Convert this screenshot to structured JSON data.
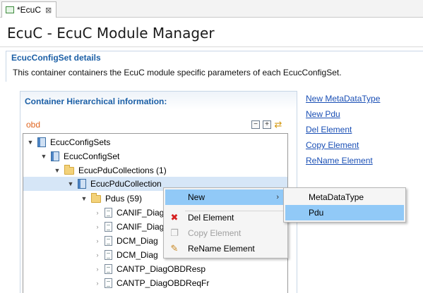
{
  "tab": {
    "label": "*EcuC",
    "close": "⊠"
  },
  "page": {
    "title": "EcuC - EcuC Module Manager"
  },
  "section": {
    "title": "EcucConfigSet details",
    "description": "This container containers the EcuC module specific parameters of each EcucConfigSet."
  },
  "container": {
    "title": "Container Hierarchical information:",
    "filter_label": "obd",
    "tools": [
      "collapse-all-icon",
      "expand-all-icon",
      "link-sync-icon"
    ]
  },
  "tree": {
    "nodes": [
      {
        "label": "EcucConfigSets",
        "icon": "config-icon",
        "expanded": true
      },
      {
        "label": "EcucConfigSet",
        "icon": "config-icon",
        "expanded": true
      },
      {
        "label": "EcucPduCollections (1)",
        "icon": "folder-icon",
        "expanded": true
      },
      {
        "label": "EcucPduCollection",
        "icon": "config-icon",
        "expanded": true,
        "selected": true
      },
      {
        "label": "Pdus (59)",
        "icon": "folder-icon",
        "expanded": true
      },
      {
        "label": "CANIF_Diag",
        "icon": "document-icon",
        "expanded": false
      },
      {
        "label": "CANIF_Diag",
        "icon": "document-icon",
        "expanded": false
      },
      {
        "label": "DCM_Diag",
        "icon": "document-icon",
        "expanded": false
      },
      {
        "label": "DCM_Diag",
        "icon": "document-icon",
        "expanded": false
      },
      {
        "label": "CANTP_DiagOBDResp",
        "icon": "document-icon",
        "expanded": false
      },
      {
        "label": "CANTP_DiagOBDReqFr",
        "icon": "document-icon",
        "expanded": false
      }
    ]
  },
  "actions": {
    "new_metadatatype": "New MetaDataType",
    "new_pdu": "New Pdu",
    "del_element": "Del Element",
    "copy_element": "Copy Element",
    "rename_element": "ReName Element"
  },
  "context_menu": {
    "new": "New",
    "del": "Del Element",
    "copy": "Copy Element",
    "rename": "ReName Element"
  },
  "submenu": {
    "metadatatype": "MetaDataType",
    "pdu": "Pdu"
  },
  "colors": {
    "link": "#1a4fb5",
    "section_title": "#1b5fa6",
    "filter_text": "#e0651f",
    "menu_highlight": "#91c9f7",
    "tree_selection": "#d6e6f7"
  }
}
